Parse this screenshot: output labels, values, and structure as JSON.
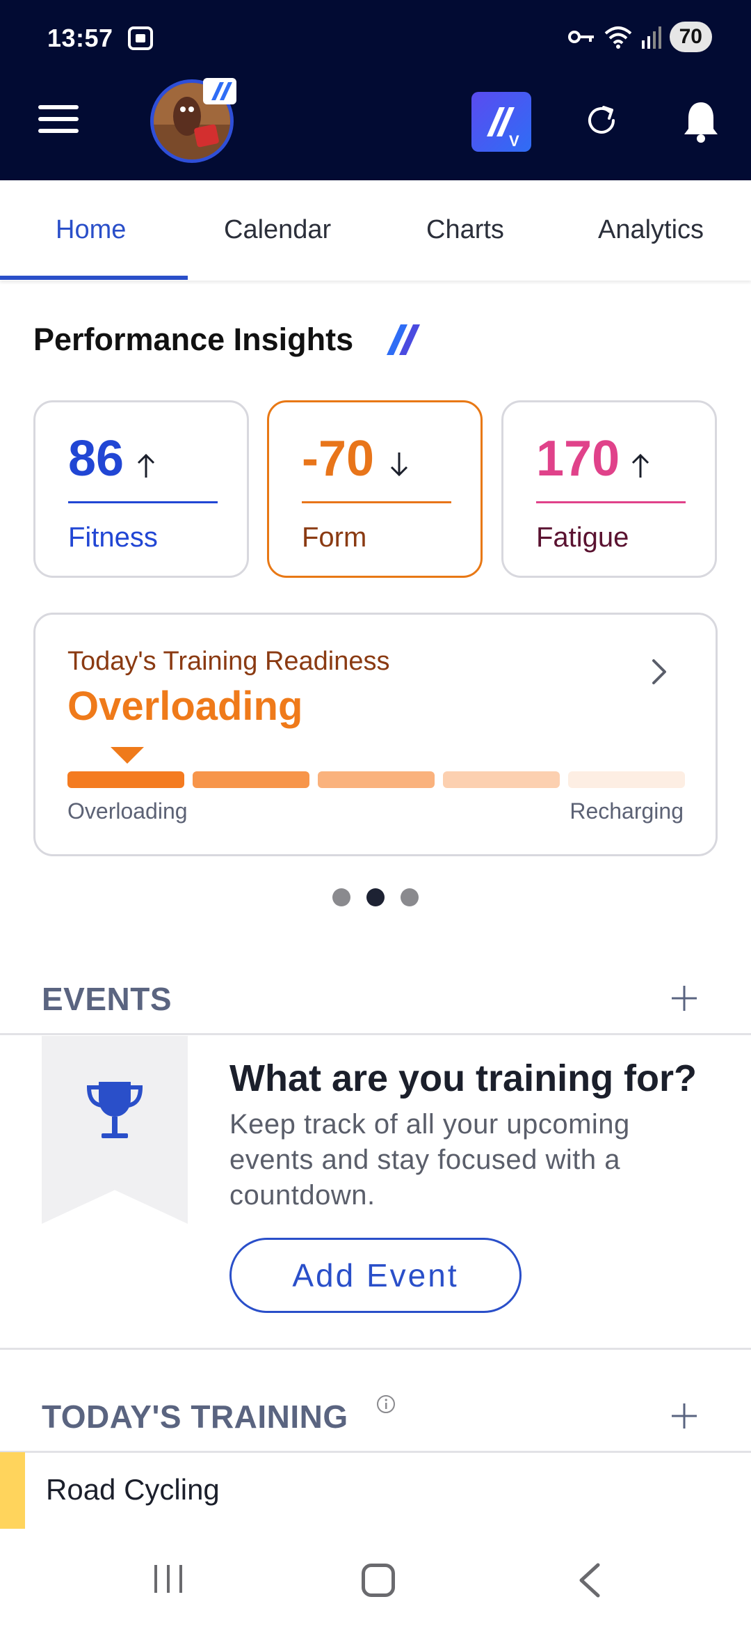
{
  "status_bar": {
    "time": "13:57",
    "battery": "70"
  },
  "tabs": [
    {
      "label": "Home",
      "active": true
    },
    {
      "label": "Calendar",
      "active": false
    },
    {
      "label": "Charts",
      "active": false
    },
    {
      "label": "Analytics",
      "active": false
    }
  ],
  "performance": {
    "title": "Performance Insights",
    "metrics": [
      {
        "value": "86",
        "label": "Fitness",
        "trend": "up",
        "color": "#2146d4",
        "label_color": "#2146d4"
      },
      {
        "value": "-70",
        "label": "Form",
        "trend": "down",
        "color": "#e8751a",
        "label_color": "#8a3a12"
      },
      {
        "value": "170",
        "label": "Fatigue",
        "trend": "up",
        "color": "#e0428a",
        "label_color": "#5a1230"
      }
    ]
  },
  "readiness": {
    "title": "Today's Training Readiness",
    "status": "Overloading",
    "scale_left": "Overloading",
    "scale_right": "Recharging",
    "segment_colors": [
      "#f47b20",
      "#f7954a",
      "#fab27d",
      "#fcd0b0",
      "#fdeee3"
    ]
  },
  "carousel": {
    "pages": 3,
    "active_index": 1
  },
  "events": {
    "section_title": "EVENTS",
    "heading": "What are you training for?",
    "body": "Keep track of all your upcoming events and stay focused with a countdown.",
    "button": "Add Event"
  },
  "training": {
    "section_title": "TODAY'S TRAINING",
    "items": [
      {
        "name": "Road Cycling",
        "color": "#ffd45c"
      }
    ]
  },
  "colors": {
    "header_bg": "#020b33",
    "accent": "#2a4fc9",
    "orange": "#ef7a1a"
  }
}
